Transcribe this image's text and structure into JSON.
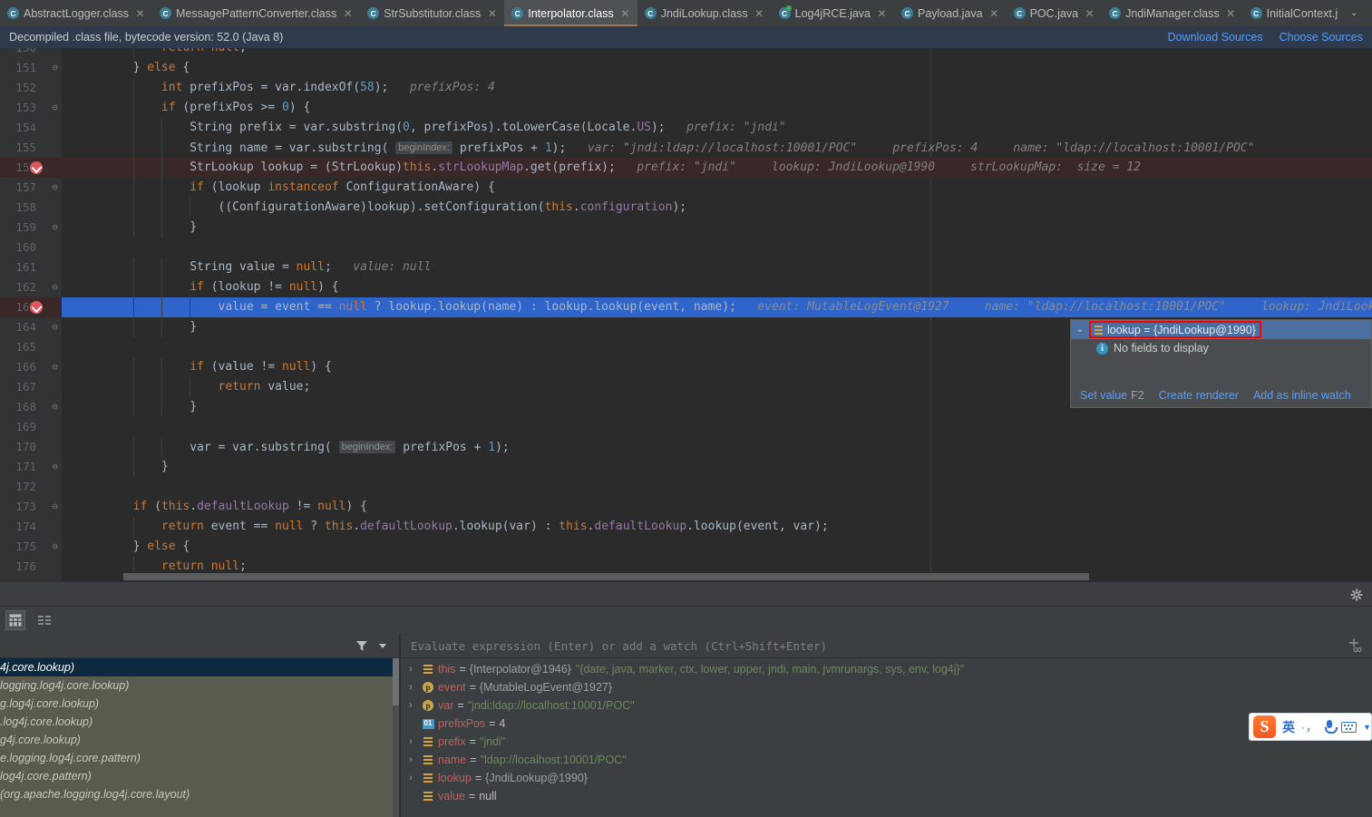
{
  "tabs": [
    {
      "label": "AbstractLogger.class",
      "icon": "class-file-icon",
      "active": false,
      "kind": "cls"
    },
    {
      "label": "MessagePatternConverter.class",
      "icon": "class-file-icon",
      "active": false,
      "kind": "cls"
    },
    {
      "label": "StrSubstitutor.class",
      "icon": "class-file-icon",
      "active": false,
      "kind": "cls"
    },
    {
      "label": "Interpolator.class",
      "icon": "class-file-icon",
      "active": true,
      "kind": "cls"
    },
    {
      "label": "JndiLookup.class",
      "icon": "class-file-icon",
      "active": false,
      "kind": "cls"
    },
    {
      "label": "Log4jRCE.java",
      "icon": "java-run-file-icon",
      "active": false,
      "kind": "jav"
    },
    {
      "label": "Payload.java",
      "icon": "class-file-icon",
      "active": false,
      "kind": "cls"
    },
    {
      "label": "POC.java",
      "icon": "class-file-icon",
      "active": false,
      "kind": "cls"
    },
    {
      "label": "JndiManager.class",
      "icon": "class-file-icon",
      "active": false,
      "kind": "cls"
    },
    {
      "label": "InitialContext.j",
      "icon": "class-file-icon",
      "active": false,
      "kind": "cls"
    }
  ],
  "tab_close_glyph": "✕",
  "tab_overflow_glyph": "⌄",
  "notification": {
    "message": "Decompiled .class file, bytecode version: 52.0 (Java 8)",
    "download_sources": "Download Sources",
    "choose_sources": "Choose Sources"
  },
  "editor": {
    "first_visible_line": 150,
    "breakpoint_lines": [
      156,
      163
    ],
    "execution_line": 163,
    "lines": [
      {
        "num": 150,
        "clipped": true,
        "html": "            <span class='k'>return</span> <span class='k'>null</span>;"
      },
      {
        "num": 151,
        "fold": "⊖",
        "html": "        } <span class='k'>else</span> {"
      },
      {
        "num": 152,
        "html": "            <span class='k'>int</span> prefixPos = var.indexOf(<span class='n'>58</span>);   <span class='hint'>prefixPos: 4</span>"
      },
      {
        "num": 153,
        "fold": "⊖",
        "html": "            <span class='k'>if</span> (prefixPos &gt;= <span class='n'>0</span>) {"
      },
      {
        "num": 154,
        "html": "                String prefix = var.substring(<span class='n'>0</span>, prefixPos).toLowerCase(Locale.<span class='fld'>US</span>);   <span class='hint'>prefix: \"jndi\"</span>"
      },
      {
        "num": 155,
        "html": "                String name = var.substring( <span class='chip'>beginIndex:</span> prefixPos + <span class='n'>1</span>);   <span class='hint'>var: \"jndi:ldap://localhost:10001/POC\"     prefixPos: 4     name: \"ldap://localhost:10001/POC\"</span>"
      },
      {
        "num": 156,
        "bp": true,
        "html": "                StrLookup lookup = (StrLookup)<span class='k'>this</span>.<span class='fld'>strLookupMap</span>.get(prefix);   <span class='hint'>prefix: \"jndi\"     lookup: JndiLookup@1990     strLookupMap:  size = 12</span>"
      },
      {
        "num": 157,
        "fold": "⊖",
        "html": "                <span class='k'>if</span> (lookup <span class='k'>instanceof</span> ConfigurationAware) {"
      },
      {
        "num": 158,
        "html": "                    ((ConfigurationAware)lookup).setConfiguration(<span class='k'>this</span>.<span class='fld'>configuration</span>);"
      },
      {
        "num": 159,
        "fold": "⊖",
        "html": "                }"
      },
      {
        "num": 160,
        "html": ""
      },
      {
        "num": 161,
        "html": "                String value = <span class='k'>null</span>;   <span class='hint'>value: null</span>"
      },
      {
        "num": 162,
        "fold": "⊖",
        "html": "                <span class='k'>if</span> (lookup != <span class='k'>null</span>) {"
      },
      {
        "num": 163,
        "bp": true,
        "exec": true,
        "html": "                    value = event == <span class='k'>null</span> ? lookup.lookup(name) : lookup.lookup(event, name);   <span class='hintv'>event: MutableLogEvent@1927     name: \"ldap://localhost:10001/POC\"     lookup: JndiLooku</span>"
      },
      {
        "num": 164,
        "fold": "⊖",
        "html": "                }"
      },
      {
        "num": 165,
        "html": ""
      },
      {
        "num": 166,
        "fold": "⊖",
        "html": "                <span class='k'>if</span> (value != <span class='k'>null</span>) {"
      },
      {
        "num": 167,
        "html": "                    <span class='k'>return</span> value;"
      },
      {
        "num": 168,
        "fold": "⊖",
        "html": "                }"
      },
      {
        "num": 169,
        "html": ""
      },
      {
        "num": 170,
        "html": "                var = var.substring( <span class='chip'>beginIndex:</span> prefixPos + <span class='n'>1</span>);"
      },
      {
        "num": 171,
        "fold": "⊖",
        "html": "            }"
      },
      {
        "num": 172,
        "html": ""
      },
      {
        "num": 173,
        "fold": "⊖",
        "html": "        <span class='k'>if</span> (<span class='k'>this</span>.<span class='fld'>defaultLookup</span> != <span class='k'>null</span>) {"
      },
      {
        "num": 174,
        "html": "            <span class='k'>return</span> event == <span class='k'>null</span> ? <span class='k'>this</span>.<span class='fld'>defaultLookup</span>.lookup(var) : <span class='k'>this</span>.<span class='fld'>defaultLookup</span>.lookup(event, var);"
      },
      {
        "num": 175,
        "fold": "⊖",
        "html": "        } <span class='k'>else</span> {"
      },
      {
        "num": 176,
        "html": "            <span class='k'>return</span> <span class='k'>null</span>;"
      }
    ]
  },
  "inline_popup": {
    "chevron": "⌄",
    "expression": "lookup = {JndiLookup@1990}",
    "no_fields": "No fields to display",
    "info_glyph": "i",
    "set_value": "Set value",
    "set_value_key": "F2",
    "create_renderer": "Create renderer",
    "add_inline_watch": "Add as inline watch",
    "highlight_color": "#ff0000"
  },
  "debugger": {
    "frames_toolbar": {
      "filter_icon": "filter-icon",
      "dropdown_icon": "chevron-down-icon"
    },
    "tools": [
      {
        "icon": "table-view-icon",
        "selected": true
      },
      {
        "icon": "list-view-icon",
        "selected": false
      }
    ],
    "gear_icon": "gear-icon",
    "frames": [
      {
        "text": "4j.core.lookup)",
        "selected": true
      },
      {
        "text": "logging.log4j.core.lookup)",
        "selected": false
      },
      {
        "text": "g.log4j.core.lookup)",
        "selected": false
      },
      {
        "text": ".log4j.core.lookup)",
        "selected": false
      },
      {
        "text": "g4j.core.lookup)",
        "selected": false
      },
      {
        "text": "e.logging.log4j.core.pattern)",
        "selected": false
      },
      {
        "text": "log4j.core.pattern)",
        "selected": false
      },
      {
        "text": "  (org.apache.logging.log4j.core.layout)",
        "selected": false
      }
    ],
    "evaluate_placeholder": "Evaluate expression (Enter) or add a watch (Ctrl+Shift+Enter)",
    "evaluate_value": "",
    "add_watch_icon": "add-watch-icon",
    "variables": [
      {
        "expandable": true,
        "icon": "variable-icon",
        "name": "this",
        "value": "{Interpolator@1946}",
        "value_class": "var-obj",
        "extra": "\"{date, java, marker, ctx, lower, upper, jndi, main, jvmrunargs, sys, env, log4j}\""
      },
      {
        "expandable": true,
        "icon": "parameter-icon",
        "name": "event",
        "value": "{MutableLogEvent@1927}",
        "value_class": "var-obj",
        "extra": ""
      },
      {
        "expandable": true,
        "icon": "parameter-icon",
        "name": "var",
        "value": "\"jndi:ldap://localhost:10001/POC\"",
        "value_class": "var-str",
        "extra": ""
      },
      {
        "expandable": false,
        "icon": "primitive-icon",
        "name": "prefixPos",
        "value": "4",
        "value_class": "var-num",
        "extra": ""
      },
      {
        "expandable": true,
        "icon": "variable-icon",
        "name": "prefix",
        "value": "\"jndi\"",
        "value_class": "var-str",
        "extra": ""
      },
      {
        "expandable": true,
        "icon": "variable-icon",
        "name": "name",
        "value": "\"ldap://localhost:10001/POC\"",
        "value_class": "var-str",
        "extra": ""
      },
      {
        "expandable": true,
        "icon": "variable-icon",
        "name": "lookup",
        "value": "{JndiLookup@1990}",
        "value_class": "var-obj",
        "extra": ""
      },
      {
        "expandable": false,
        "icon": "variable-icon",
        "name": "value",
        "value": "null",
        "value_class": "var-null",
        "extra": ""
      }
    ]
  },
  "ime": {
    "logo_text": "S",
    "lang_label": "英",
    "punct_label": "·，",
    "mic_icon": "microphone-icon",
    "keyboard_icon": "keyboard-icon",
    "caret_icon": "chevron-down-icon"
  },
  "colors": {
    "editor_bg": "#2b2b2b",
    "gutter_bg": "#313335",
    "panel_bg": "#3c3f41",
    "accent_blue": "#589df6",
    "selection_blue": "#2f65ca",
    "breakpoint_red": "#db5860",
    "frames_bg": "#5b5a4f"
  }
}
